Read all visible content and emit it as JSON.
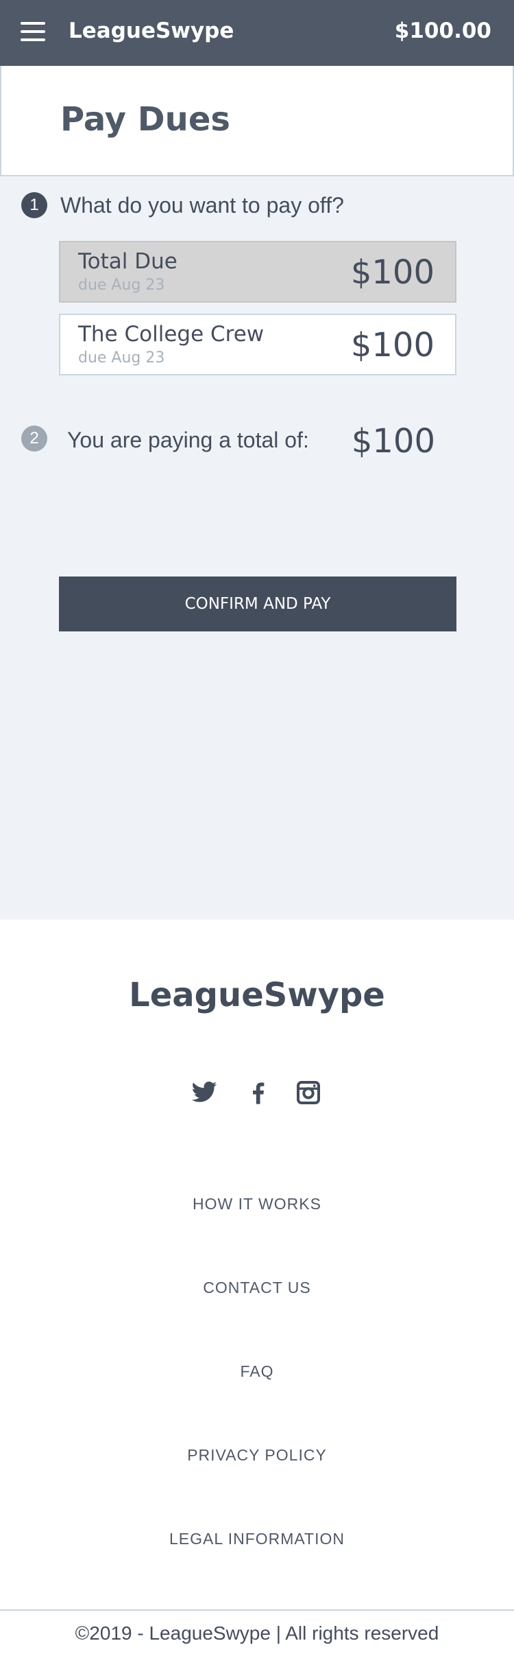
{
  "header": {
    "brand": "LeagueSwype",
    "balance": "$100.00",
    "menu_icon": "hamburger-menu-icon"
  },
  "page": {
    "title": "Pay Dues"
  },
  "step1": {
    "number": "1",
    "question": "What do you want to pay off?",
    "options": [
      {
        "name": "Total Due",
        "due": "due Aug 23",
        "amount": "$100",
        "selected": true
      },
      {
        "name": "The College Crew",
        "due": "due Aug 23",
        "amount": "$100",
        "selected": false
      }
    ]
  },
  "step2": {
    "number": "2",
    "label": "You are paying a total of:",
    "amount": "$100"
  },
  "confirm_label": "CONFIRM AND PAY",
  "footer": {
    "logo": "LeagueSwype",
    "social": [
      "twitter-icon",
      "facebook-icon",
      "instagram-icon"
    ],
    "links": [
      "HOW IT WORKS",
      "CONTACT US",
      "FAQ",
      "PRIVACY POLICY",
      "LEGAL INFORMATION"
    ],
    "copyright": "©2019 - LeagueSwype | All rights reserved"
  },
  "colors": {
    "header_bg": "#4f5967",
    "main_bg": "#eff3f7",
    "dark": "#444d5c",
    "muted": "#9ea8b2",
    "border": "#c9d6de"
  }
}
